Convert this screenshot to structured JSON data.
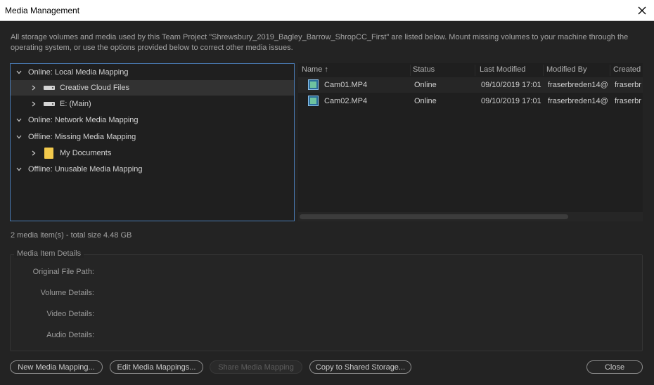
{
  "window": {
    "title": "Media Management"
  },
  "intro_text": "All storage volumes and media used by this Team Project \"Shrewsbury_2019_Bagley_Barrow_ShropCC_First\" are listed below. Mount missing volumes to your machine through the operating system, or use the options provided below to correct other media issues.",
  "tree": {
    "items": [
      {
        "label": "Online: Local Media Mapping"
      },
      {
        "label": "Creative Cloud Files"
      },
      {
        "label": "E: (Main)"
      },
      {
        "label": "Online: Network Media Mapping"
      },
      {
        "label": "Offline: Missing Media Mapping"
      },
      {
        "label": "My Documents"
      },
      {
        "label": "Offline: Unusable Media Mapping"
      }
    ]
  },
  "list": {
    "columns": [
      "Name",
      "Status",
      "Last Modified",
      "Modified By",
      "Created"
    ],
    "sort_indicator": "↑",
    "rows": [
      {
        "name": "Cam01.MP4",
        "status": "Online",
        "modified": "09/10/2019 17:01",
        "modified_by": "fraserbreden14@",
        "created": "fraserbr"
      },
      {
        "name": "Cam02.MP4",
        "status": "Online",
        "modified": "09/10/2019 17:01",
        "modified_by": "fraserbreden14@",
        "created": "fraserbr"
      }
    ]
  },
  "summary": "2 media item(s) - total size 4.48 GB",
  "details": {
    "legend": "Media Item Details",
    "labels": {
      "original_path": "Original File Path:",
      "volume": "Volume Details:",
      "video": "Video Details:",
      "audio": "Audio Details:"
    }
  },
  "buttons": {
    "new_mapping": "New Media Mapping...",
    "edit_mappings": "Edit Media Mappings...",
    "share_mapping": "Share Media Mapping",
    "copy_shared": "Copy to Shared Storage...",
    "close": "Close"
  },
  "colors": {
    "accent": "#4a7bb5",
    "folder": "#f2c94c"
  }
}
